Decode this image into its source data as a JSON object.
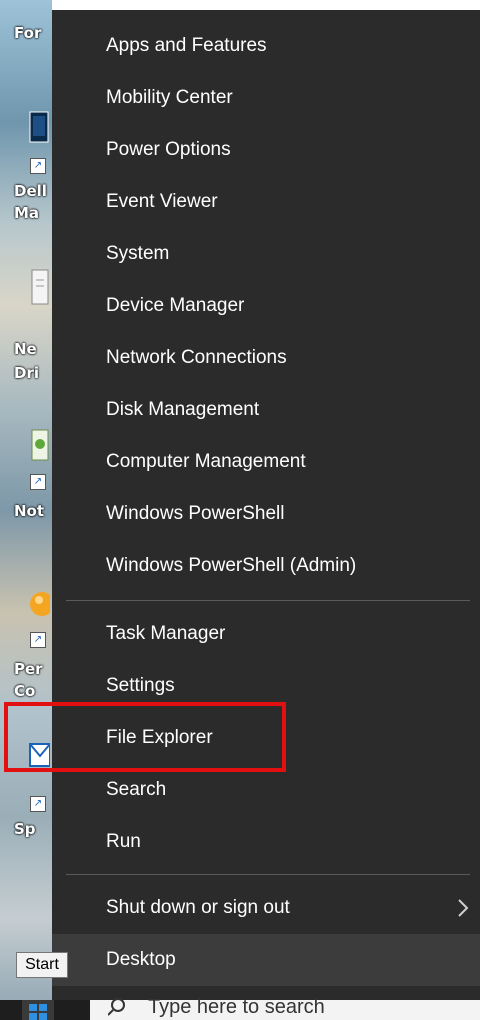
{
  "desktop": {
    "labels": [
      "For",
      "Dell",
      "Ma",
      "Ne",
      "Dri",
      "Not",
      "Per",
      "Co",
      "Sp"
    ]
  },
  "menu": {
    "group1": [
      "Apps and Features",
      "Mobility Center",
      "Power Options",
      "Event Viewer",
      "System",
      "Device Manager",
      "Network Connections",
      "Disk Management",
      "Computer Management",
      "Windows PowerShell",
      "Windows PowerShell (Admin)"
    ],
    "group2": [
      "Task Manager",
      "Settings",
      "File Explorer",
      "Search",
      "Run"
    ],
    "group3": [
      "Shut down or sign out",
      "Desktop"
    ]
  },
  "taskbar": {
    "tooltip": "Start",
    "search_placeholder": "Type here to search"
  },
  "colors": {
    "menu_bg": "#2b2b2b",
    "highlight_border": "#e21010",
    "hover_bg": "#3c3c3c"
  }
}
